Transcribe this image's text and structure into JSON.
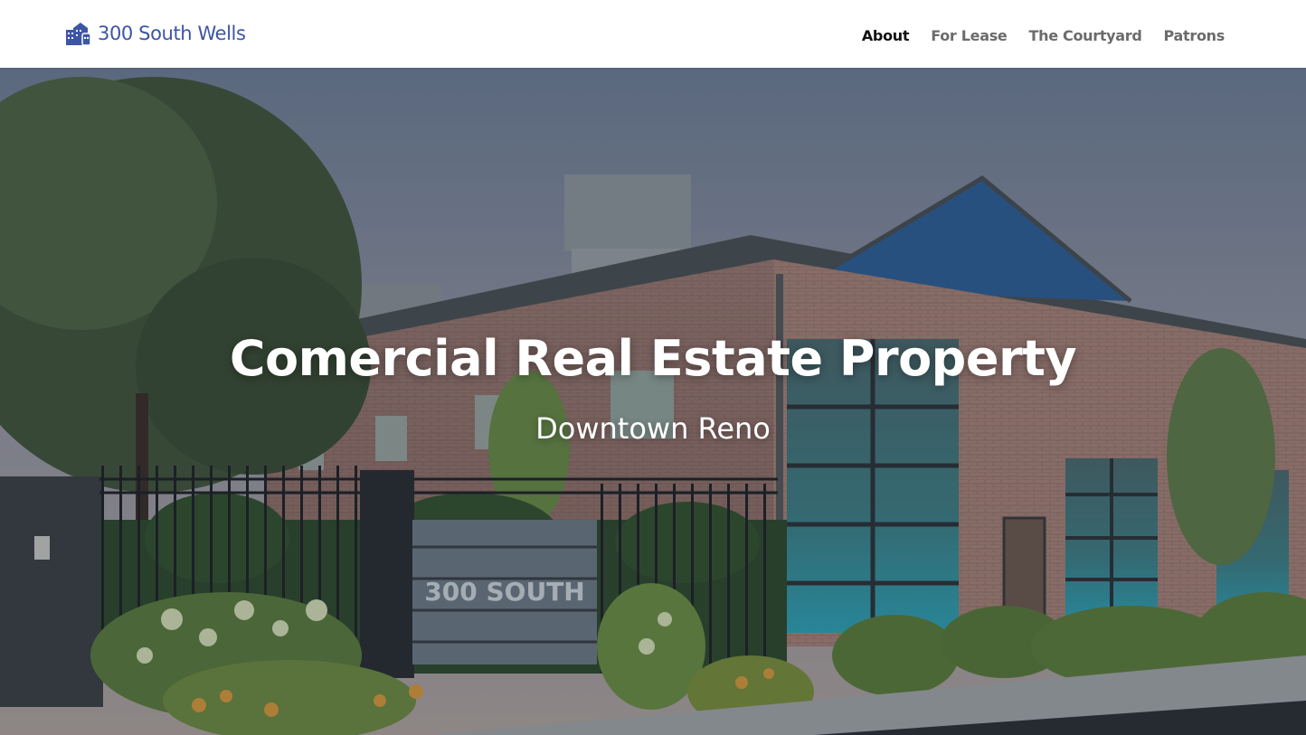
{
  "site": {
    "logo_text": "300 South Wells",
    "logo_icon": "building-icon",
    "brand_color": "#3d55a6"
  },
  "nav": {
    "items": [
      {
        "label": "About",
        "active": true
      },
      {
        "label": "For Lease",
        "active": false
      },
      {
        "label": "The Courtyard",
        "active": false
      },
      {
        "label": "Patrons",
        "active": false
      }
    ]
  },
  "hero": {
    "title": "Comercial Real Estate Property",
    "subtitle": "Downtown Reno",
    "sign_text": "300 SOUTH"
  }
}
